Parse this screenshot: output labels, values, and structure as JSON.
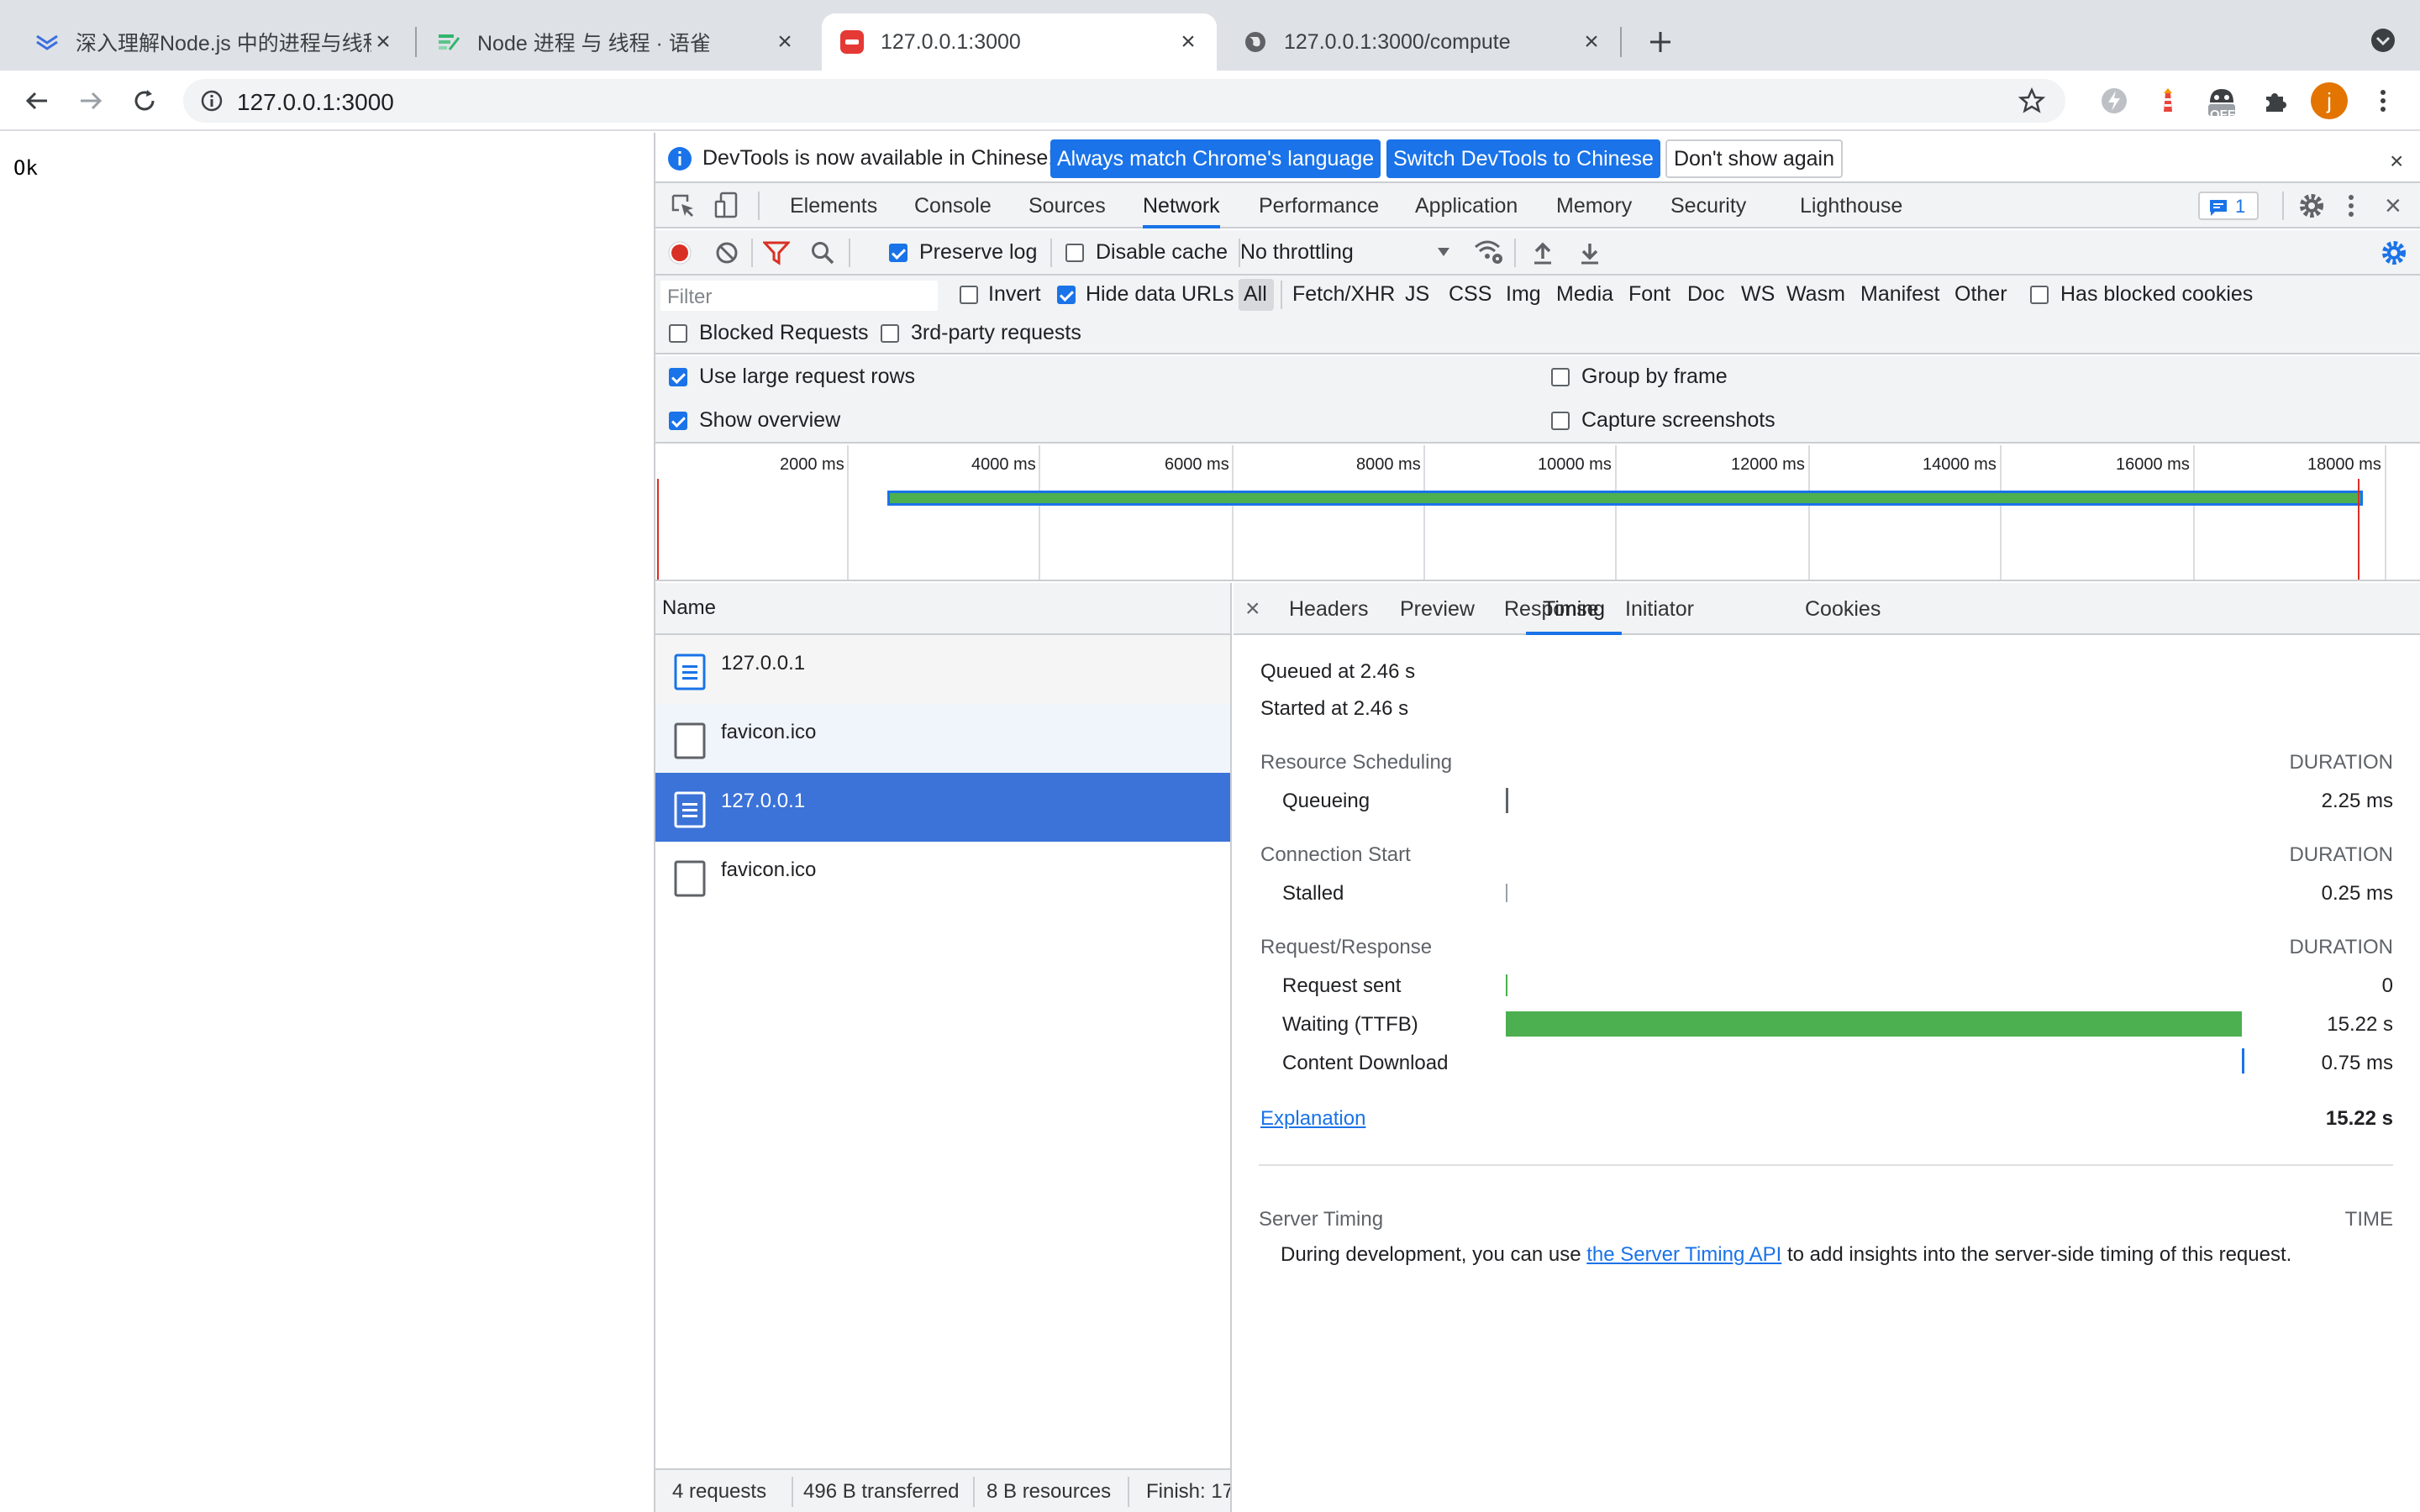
{
  "browser": {
    "tabs": [
      {
        "title": "深入理解Node.js 中的进程与线程",
        "active": false
      },
      {
        "title": "Node 进程 与 线程 · 语雀",
        "active": false
      },
      {
        "title": "127.0.0.1:3000",
        "active": true
      },
      {
        "title": "127.0.0.1:3000/compute",
        "active": false
      }
    ],
    "url": "127.0.0.1:3000",
    "avatar_letter": "j",
    "extension_badge": "OFF"
  },
  "page": {
    "body_text": "Ok"
  },
  "devtools": {
    "infobar": {
      "message": "DevTools is now available in Chinese!",
      "btn_match": "Always match Chrome's language",
      "btn_switch": "Switch DevTools to Chinese",
      "btn_dismiss": "Don't show again"
    },
    "panels": [
      "Elements",
      "Console",
      "Sources",
      "Network",
      "Performance",
      "Application",
      "Memory",
      "Security",
      "Lighthouse"
    ],
    "active_panel": "Network",
    "issues_count": "1",
    "toolbar": {
      "preserve_log": "Preserve log",
      "disable_cache": "Disable cache",
      "throttling": "No throttling"
    },
    "filter": {
      "placeholder": "Filter",
      "invert": "Invert",
      "hide_data_urls": "Hide data URLs",
      "types": [
        "All",
        "Fetch/XHR",
        "JS",
        "CSS",
        "Img",
        "Media",
        "Font",
        "Doc",
        "WS",
        "Wasm",
        "Manifest",
        "Other"
      ],
      "has_blocked_cookies": "Has blocked cookies",
      "blocked_requests": "Blocked Requests",
      "third_party": "3rd-party requests"
    },
    "settings": {
      "large_rows": "Use large request rows",
      "show_overview": "Show overview",
      "group_by_frame": "Group by frame",
      "capture_screenshots": "Capture screenshots"
    },
    "overview": {
      "ticks": [
        "2000 ms",
        "4000 ms",
        "6000 ms",
        "8000 ms",
        "10000 ms",
        "12000 ms",
        "14000 ms",
        "16000 ms",
        "18000 ms"
      ]
    },
    "requests": {
      "header": "Name",
      "rows": [
        {
          "name": "127.0.0.1",
          "type": "document"
        },
        {
          "name": "favicon.ico",
          "type": "other"
        },
        {
          "name": "127.0.0.1",
          "type": "document"
        },
        {
          "name": "favicon.ico",
          "type": "other"
        }
      ],
      "status": {
        "requests": "4 requests",
        "transferred": "496 B transferred",
        "resources": "8 B resources",
        "finish": "Finish: 17"
      }
    },
    "detail": {
      "tabs": [
        "Headers",
        "Preview",
        "Response",
        "Initiator",
        "Timing",
        "Cookies"
      ],
      "active_tab": "Timing",
      "queued": "Queued at 2.46 s",
      "started": "Started at 2.46 s",
      "sections": [
        {
          "title": "Resource Scheduling",
          "col": "DURATION",
          "rows": [
            {
              "label": "Queueing",
              "value": "2.25 ms"
            }
          ]
        },
        {
          "title": "Connection Start",
          "col": "DURATION",
          "rows": [
            {
              "label": "Stalled",
              "value": "0.25 ms"
            }
          ]
        },
        {
          "title": "Request/Response",
          "col": "DURATION",
          "rows": [
            {
              "label": "Request sent",
              "value": "0"
            },
            {
              "label": "Waiting (TTFB)",
              "value": "15.22 s"
            },
            {
              "label": "Content Download",
              "value": "0.75 ms"
            }
          ]
        }
      ],
      "explanation": "Explanation",
      "total": "15.22 s",
      "server_timing": {
        "title": "Server Timing",
        "col": "TIME",
        "text_before": "During development, you can use ",
        "link": "the Server Timing API",
        "text_after": " to add insights into the server-side timing of this request."
      }
    }
  },
  "colors": {
    "accent": "#1a73e8",
    "waiting_bar": "#4caf50",
    "record": "#d93025",
    "selected_row": "#3b73d8"
  }
}
